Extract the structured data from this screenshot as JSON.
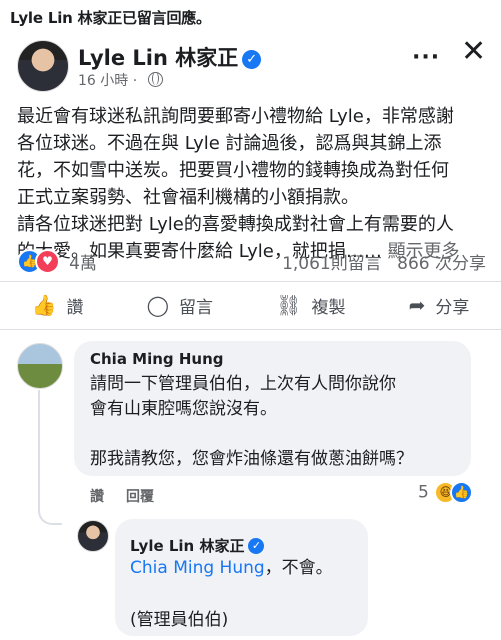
{
  "notification": "Lyle Lin 林家正已留言回應。",
  "post": {
    "author": "Lyle Lin 林家正",
    "time": "16 小時",
    "lines": [
      "最近會有球迷私訊詢問要郵寄小禮物給 Lyle，非常感謝",
      "各位球迷。不過在與 Lyle 討論過後，認爲與其錦上添",
      "花，不如雪中送炭。把要買小禮物的錢轉換成為對任何",
      "正式立案弱勢、社會福利機構的小額捐款。",
      "請各位球迷把對 Lyle的喜愛轉換成對社會上有需要的人",
      "的大愛。如果真要寄什麼給 Lyle，就把捐……"
    ],
    "see_more": "顯示更多",
    "reaction_count": "4萬",
    "comments_count": "1,061則留言",
    "shares_count": "866 次分享"
  },
  "actions": {
    "like": "讚",
    "comment": "留言",
    "copy": "複製",
    "share": "分享"
  },
  "comment": {
    "author": "Chia Ming Hung",
    "lines": [
      "請問一下管理員伯伯，上次有人問你說你",
      "會有山東腔嗎您說沒有。",
      "",
      "那我請教您，您會炸油條還有做蔥油餅嗎？"
    ],
    "like_label": "讚",
    "reply_label": "回覆",
    "reaction_count": "5"
  },
  "reply": {
    "author": "Lyle Lin 林家正",
    "mention": "Chia Ming Hung",
    "text_after_mention": "，不會。",
    "signature": "(管理員伯伯)"
  },
  "icons": {
    "more": "more-icon",
    "close": "close-icon",
    "like": "thumbs-up-icon",
    "comment": "speech-bubble-icon",
    "copy": "link-icon",
    "share": "share-arrow-icon"
  },
  "colors": {
    "accent": "#1877f2",
    "love": "#f33e58",
    "haha": "#f7b928",
    "bubble": "#f0f2f5",
    "muted": "#65676b"
  }
}
